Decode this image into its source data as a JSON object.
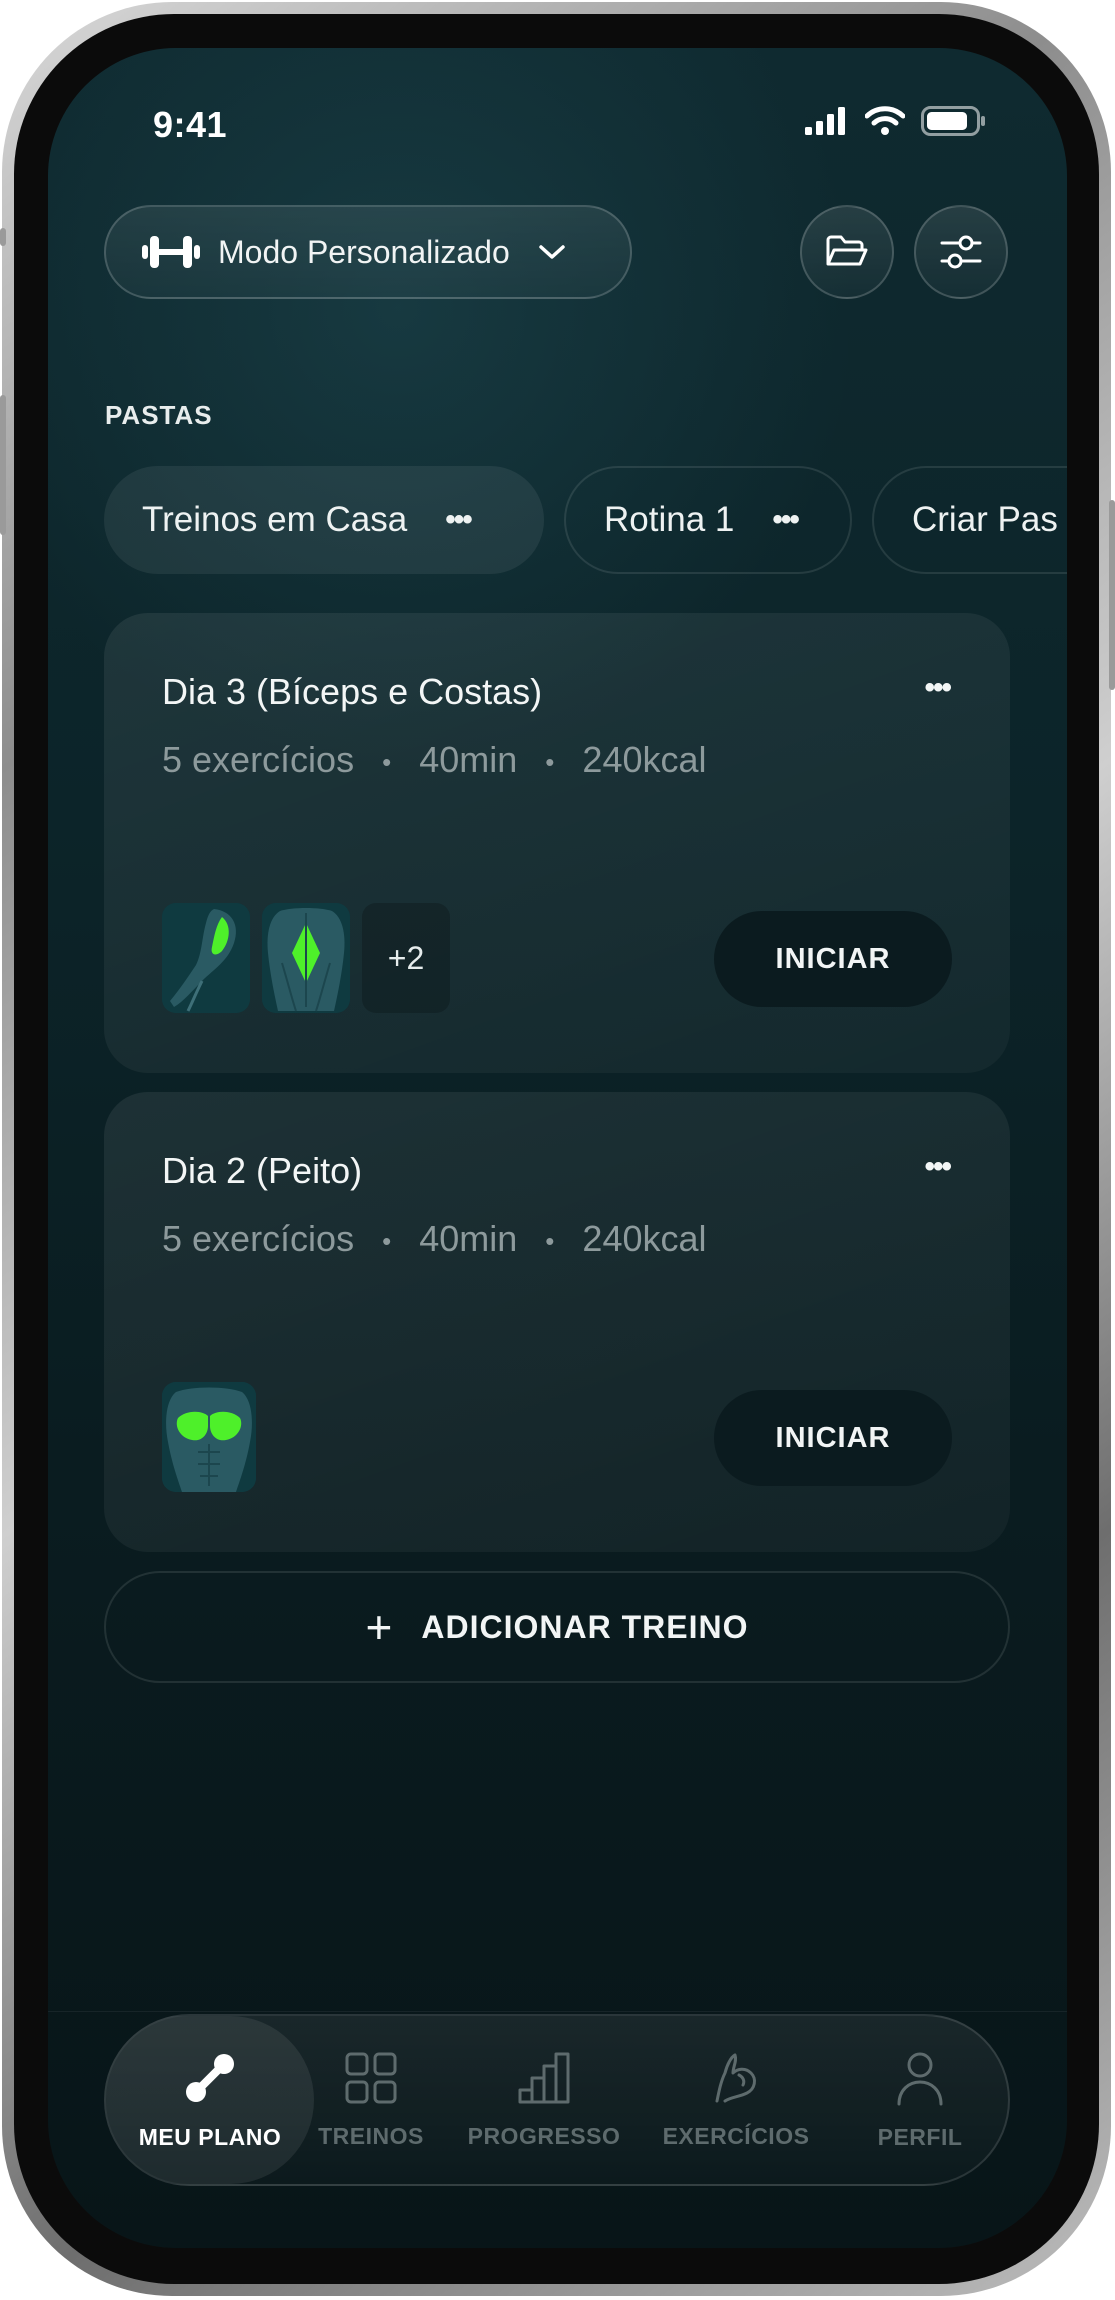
{
  "status_bar": {
    "time": "9:41"
  },
  "header": {
    "mode_label": "Modo Personalizado"
  },
  "folders": {
    "section_label": "PASTAS",
    "chips": [
      {
        "label": "Treinos em Casa",
        "more": "•••"
      },
      {
        "label": "Rotina 1",
        "more": "•••"
      },
      {
        "label": "Criar Pas"
      }
    ]
  },
  "workouts": [
    {
      "title": "Dia 3 (Bíceps e Costas)",
      "exercises": "5 exercícios",
      "duration": "40min",
      "calories": "240kcal",
      "separator": "•",
      "more": "•••",
      "extra_muscles": "+2",
      "start_label": "INICIAR"
    },
    {
      "title": "Dia 2 (Peito)",
      "exercises": "5 exercícios",
      "duration": "40min",
      "calories": "240kcal",
      "separator": "•",
      "more": "•••",
      "start_label": "INICIAR"
    }
  ],
  "add_workout": {
    "plus": "+",
    "label": "ADICIONAR TREINO"
  },
  "nav": [
    {
      "label": "MEU PLANO",
      "icon": "plan-icon",
      "active": true
    },
    {
      "label": "TREINOS",
      "icon": "grid-icon"
    },
    {
      "label": "PROGRESSO",
      "icon": "bar-chart-icon"
    },
    {
      "label": "EXERCÍCIOS",
      "icon": "bicep-icon"
    },
    {
      "label": "PERFIL",
      "icon": "person-icon"
    }
  ],
  "colors": {
    "accent_muscle": "#4ef02a",
    "screen_bg": "#0c2429"
  }
}
